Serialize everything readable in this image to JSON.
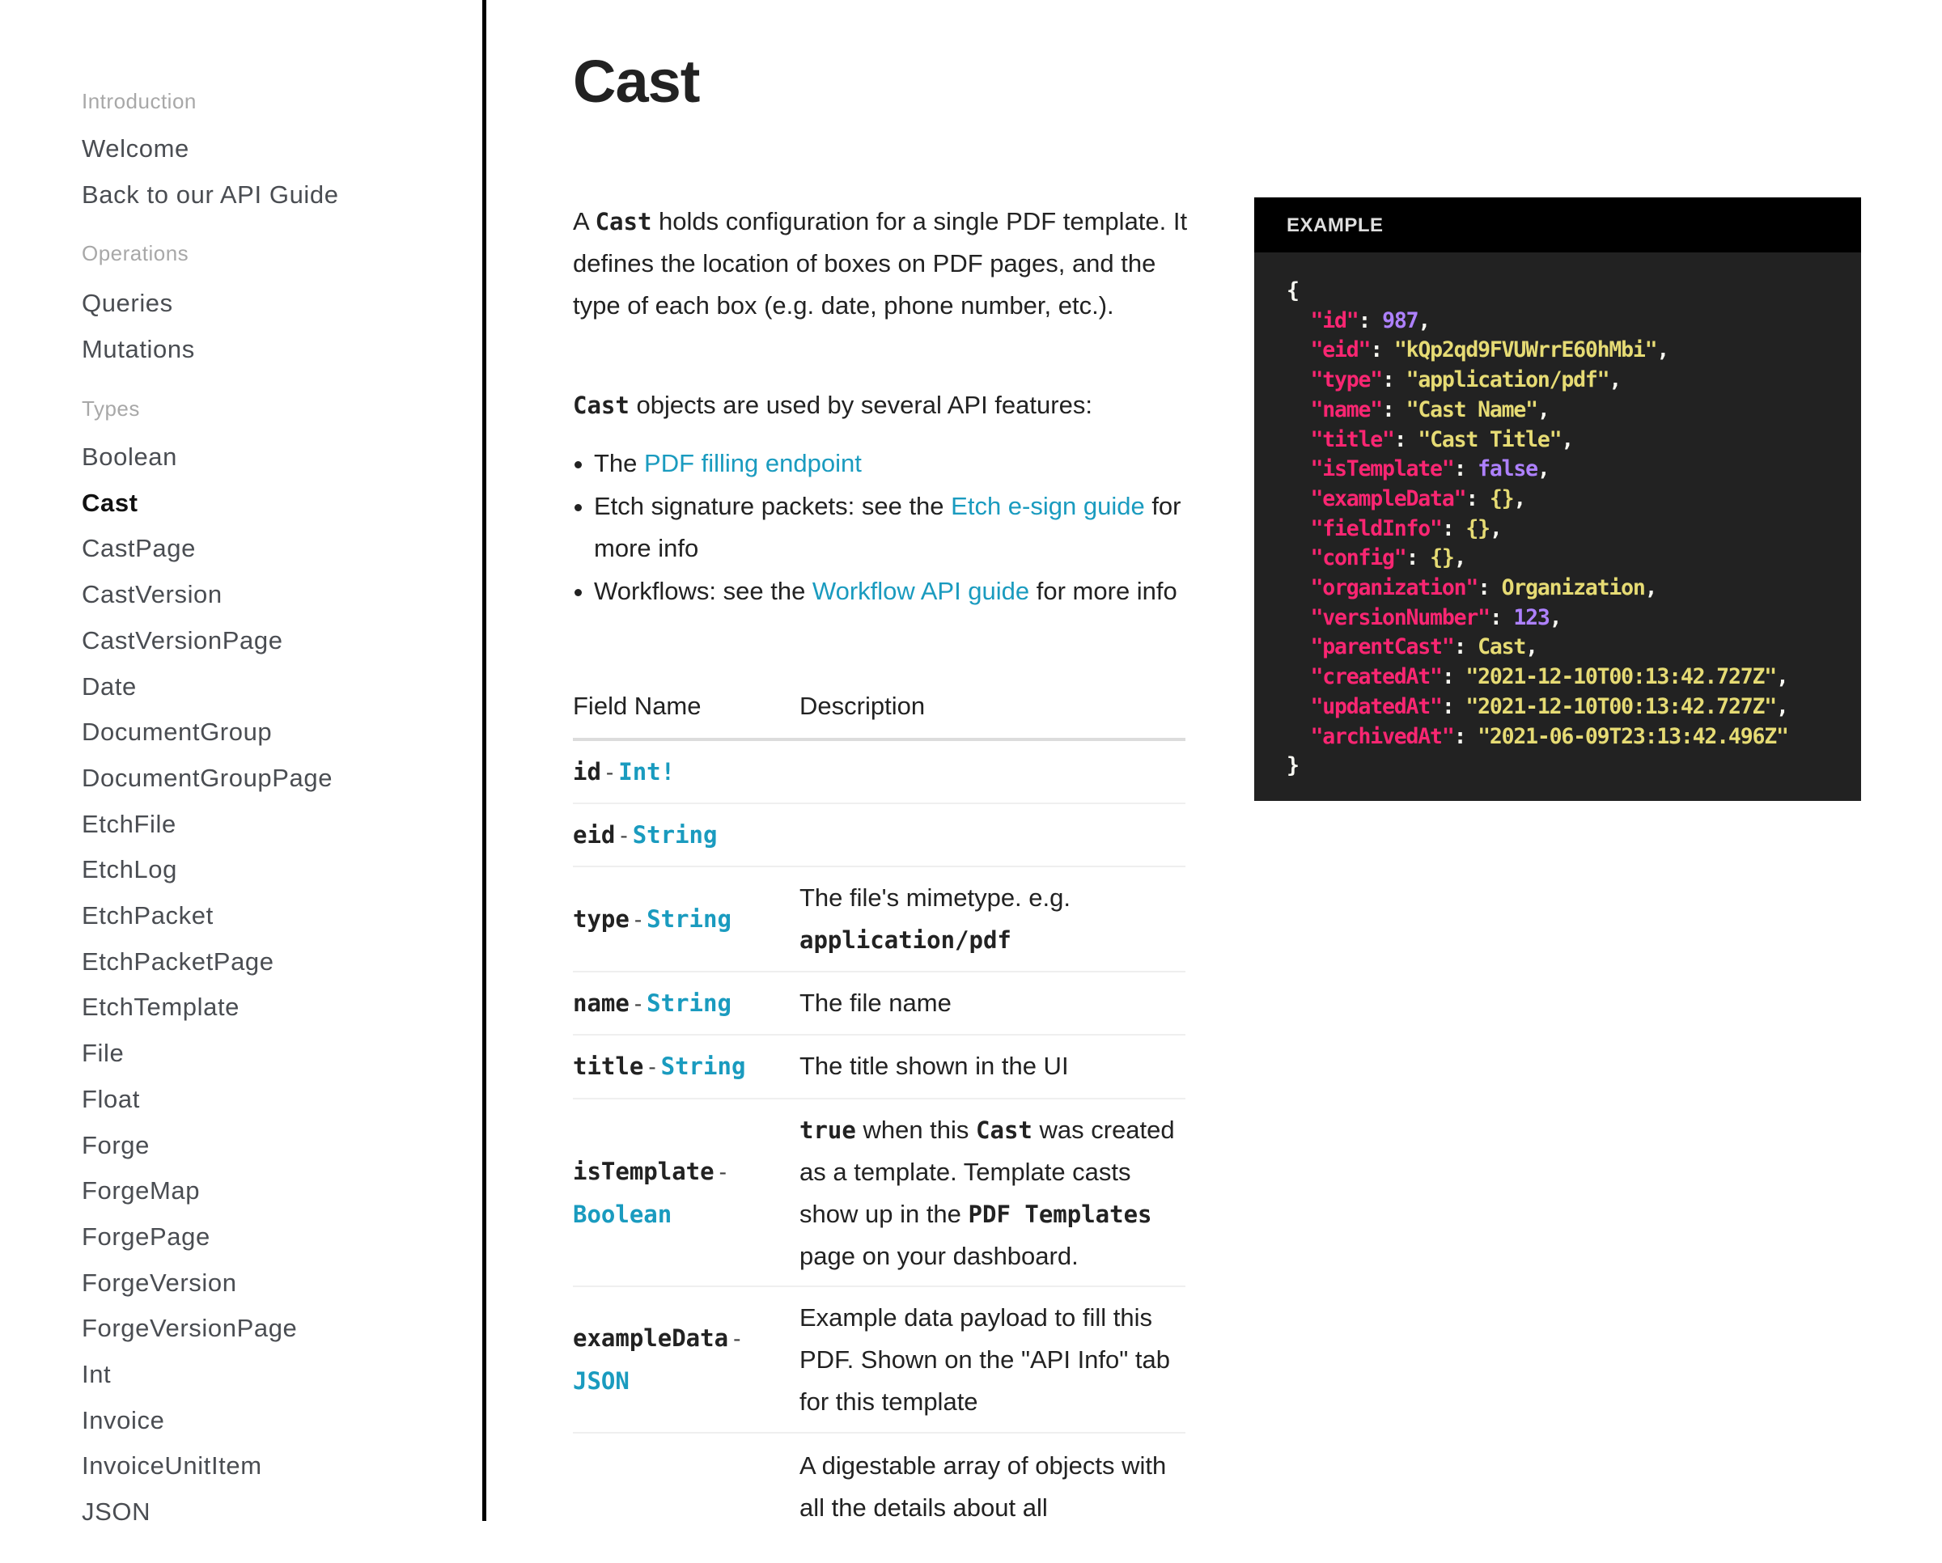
{
  "sidebar": {
    "sections": [
      {
        "title": "Introduction",
        "items": [
          "Welcome",
          "Back to our API Guide"
        ]
      },
      {
        "title": "Operations",
        "items": [
          "Queries",
          "Mutations"
        ]
      },
      {
        "title": "Types",
        "items": [
          "Boolean",
          "Cast",
          "CastPage",
          "CastVersion",
          "CastVersionPage",
          "Date",
          "DocumentGroup",
          "DocumentGroupPage",
          "EtchFile",
          "EtchLog",
          "EtchPacket",
          "EtchPacketPage",
          "EtchTemplate",
          "File",
          "Float",
          "Forge",
          "ForgeMap",
          "ForgePage",
          "ForgeVersion",
          "ForgeVersionPage",
          "Int",
          "Invoice",
          "InvoiceUnitItem",
          "JSON"
        ]
      }
    ],
    "active_item": "Cast"
  },
  "main": {
    "title": "Cast",
    "intro": {
      "a": "A ",
      "cast": "Cast",
      "rest": " holds configuration for a single PDF template. It defines the location of boxes on PDF pages, and the type of each box (e.g. date, phone number, etc.)."
    },
    "usage": {
      "cast": "Cast",
      "rest": " objects are used by several API features:"
    },
    "bullets": [
      {
        "before": "The ",
        "link": "PDF filling endpoint",
        "after": ""
      },
      {
        "before": "Etch signature packets: see the ",
        "link": "Etch e-sign guide",
        "after": " for more info"
      },
      {
        "before": "Workflows: see the ",
        "link": "Workflow API guide",
        "after": " for more info"
      }
    ],
    "table": {
      "headers": [
        "Field Name",
        "Description"
      ],
      "separator": "-",
      "rows": [
        {
          "field": "id",
          "type": "Int!"
        },
        {
          "field": "eid",
          "type": "String"
        },
        {
          "field": "type",
          "type": "String",
          "desc": "The file's mimetype. e.g.",
          "desc_code": "application/pdf"
        },
        {
          "field": "name",
          "type": "String",
          "desc": "The file name"
        },
        {
          "field": "title",
          "type": "String",
          "desc": "The title shown in the UI"
        },
        {
          "field": "isTemplate",
          "type": "Boolean",
          "desc_parts": [
            "true",
            " when this ",
            "Cast",
            " was created as a template. Template casts show up in the ",
            "PDF Templates",
            " page on your dashboard."
          ]
        },
        {
          "field": "exampleData",
          "type": "JSON",
          "desc": "Example data payload to fill this PDF. Shown on the \"API Info\" tab for this template"
        },
        {
          "field": "",
          "type": "",
          "desc": "A digestable array of objects with all the details about all"
        }
      ]
    }
  },
  "example": {
    "label": "EXAMPLE",
    "lines": [
      {
        "key": "id",
        "value": "987",
        "kind": "n",
        "comma": true
      },
      {
        "key": "eid",
        "value": "\"kQp2qd9FVUWrrE60hMbi\"",
        "kind": "s",
        "comma": true
      },
      {
        "key": "type",
        "value": "\"application/pdf\"",
        "kind": "s",
        "comma": true
      },
      {
        "key": "name",
        "value": "\"Cast Name\"",
        "kind": "s",
        "comma": true
      },
      {
        "key": "title",
        "value": "\"Cast Title\"",
        "kind": "s",
        "comma": true
      },
      {
        "key": "isTemplate",
        "value": "false",
        "kind": "n",
        "comma": true
      },
      {
        "key": "exampleData",
        "value": "{}",
        "kind": "s",
        "comma": true
      },
      {
        "key": "fieldInfo",
        "value": "{}",
        "kind": "s",
        "comma": true
      },
      {
        "key": "config",
        "value": "{}",
        "kind": "s",
        "comma": true
      },
      {
        "key": "organization",
        "value": "Organization",
        "kind": "s",
        "comma": true
      },
      {
        "key": "versionNumber",
        "value": "123",
        "kind": "n",
        "comma": true
      },
      {
        "key": "parentCast",
        "value": "Cast",
        "kind": "s",
        "comma": true
      },
      {
        "key": "createdAt",
        "value": "\"2021-12-10T00:13:42.727Z\"",
        "kind": "s",
        "comma": true
      },
      {
        "key": "updatedAt",
        "value": "\"2021-12-10T00:13:42.727Z\"",
        "kind": "s",
        "comma": true
      },
      {
        "key": "archivedAt",
        "value": "\"2021-06-09T23:13:42.496Z\"",
        "kind": "s",
        "comma": false
      }
    ]
  },
  "colors": {
    "link": "#1a9bbf",
    "code_key": "#f92672",
    "code_number": "#ae81ff",
    "code_string": "#e6db74",
    "code_bg": "#222222",
    "code_header_bg": "#000000"
  }
}
